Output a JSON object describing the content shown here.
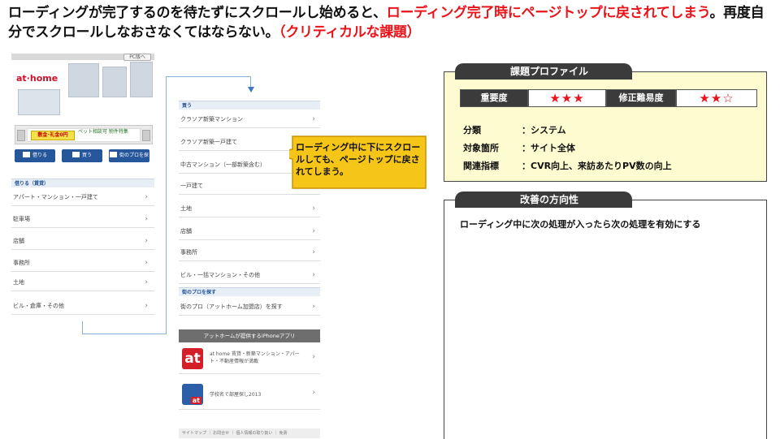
{
  "headline": {
    "part1": "ローディングが完了するのを待たずにスクロールし始めると、",
    "part2_red": "ローディング完了時にページトップに戻されてしまう",
    "part3": "。再度自分でスクロールしなおさなくてはならない。",
    "part4_red": "（クリティカルな課題）"
  },
  "phone1": {
    "pc_button": "PC版へ",
    "logo": "at·home",
    "banner_yellow": "敷金･礼金0円",
    "banner_text": "ペット相談可 物件特集",
    "nav_buttons": [
      "借りる",
      "買う",
      "街のプロを探す"
    ],
    "section_title": "借りる（賃貸）",
    "rows": [
      "アパート・マンション・一戸建て",
      "駐車場",
      "店舗",
      "事務所",
      "土地",
      "ビル・倉庫・その他"
    ]
  },
  "phone2": {
    "section_buy": "買う",
    "rows_buy": [
      "クラソア新築マンション",
      "クラソア新築一戸建て",
      "中古マンション（一部新築含む）",
      "一戸建て",
      "土地",
      "店舗",
      "事務所",
      "ビル・一括マンション・その他"
    ],
    "section_pro": "街のプロを探す",
    "row_pro": "街のプロ（アットホーム加盟店）を探す",
    "app_header": "アットホームが提供するiPhoneアプリ",
    "apps": [
      {
        "icon": "at",
        "text": "at home 賃貸・新築マンション・アパート・不動産情報が満載"
      },
      {
        "icon": "at",
        "text": "学校名で部屋探し2013"
      }
    ],
    "footer": "サイトマップ ｜ お問合せ ｜ 個人情報の取り扱い ｜ 免責"
  },
  "callout": {
    "text": "ローディング中に下にスクロールしても、ページトップに戻されてしまう。",
    "color": "#f5c518"
  },
  "profile": {
    "title": "課題プロファイル",
    "importance_label": "重要度",
    "importance_stars": "★★★",
    "difficulty_label": "修正難易度",
    "difficulty_stars": "★★☆",
    "items": [
      {
        "label": "分類",
        "value": "：システム"
      },
      {
        "label": "対象箇所",
        "value": "：サイト全体"
      },
      {
        "label": "関連指標",
        "value": "：CVR向上、来訪あたりPV数の向上"
      }
    ],
    "bg_color": "#fffbd0"
  },
  "direction": {
    "title": "改善の方向性",
    "text": "ローディング中に次の処理が入ったら次の処理を有効にする"
  }
}
